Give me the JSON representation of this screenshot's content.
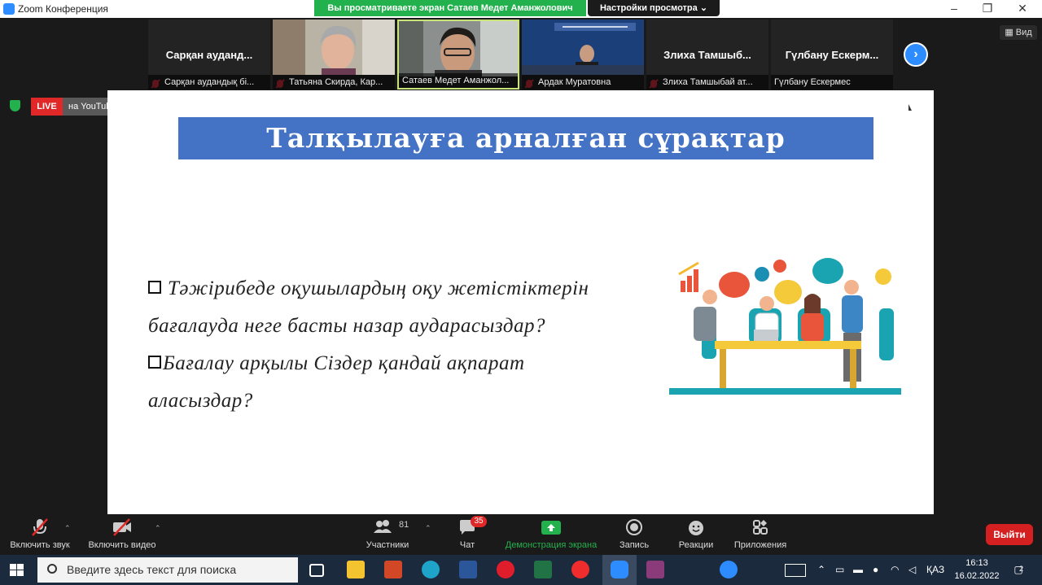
{
  "window": {
    "title": "Zoom Конференция",
    "minimize": "–",
    "restore": "❐",
    "close": "✕"
  },
  "banner": {
    "sharing_text": "Вы просматриваете экран Сатаев Медет Аманжолович",
    "view_options": "Настройки просмотра ⌄"
  },
  "view_button": "▦ Вид",
  "participants": [
    {
      "big": "Сарқан ауданд...",
      "label": "Сарқан аудандық бі...",
      "muted": true,
      "video": false
    },
    {
      "big": "",
      "label": "Татьяна Скирда, Кар...",
      "muted": true,
      "video": true
    },
    {
      "big": "",
      "label": "Сатаев Медет Аманжол...",
      "muted": false,
      "video": true
    },
    {
      "big": "",
      "label": "Ардак Муратовна",
      "muted": true,
      "video": true
    },
    {
      "big": "Злиха Тамшыб...",
      "label": "Злиха Тамшыбай ат...",
      "muted": true,
      "video": false
    },
    {
      "big": "Гүлбану Ескерм...",
      "label": "Гүлбану Ескермес",
      "muted": false,
      "video": false
    }
  ],
  "live": {
    "badge": "LIVE",
    "destination": "на YouTube ▾"
  },
  "slide": {
    "title": "Талқылауға арналған сұрақтар",
    "question1_line1": "Тәжірибеде оқушылардың оқу жетістіктерін",
    "question1_line2": "бағалауда неге басты назар аударасыздар?",
    "question2_line1": "Бағалау арқылы Сіздер қандай ақпарат",
    "question2_line2": "аласыздар?"
  },
  "toolbar": {
    "audio": "Включить звук",
    "video": "Включить видео",
    "participants": "Участники",
    "participants_count": "81",
    "chat": "Чат",
    "chat_badge": "35",
    "share": "Демонстрация экрана",
    "record": "Запись",
    "reactions": "Реакции",
    "apps": "Приложения",
    "leave": "Выйти"
  },
  "taskbar": {
    "search_placeholder": "Введите здесь текст для поиска",
    "lang": "ҚАЗ",
    "time": "16:13",
    "date": "16.02.2022",
    "notif_count": "2"
  },
  "colors": {
    "zoom_blue": "#2d8cff",
    "share_green": "#23b14d",
    "slide_banner": "#4472c4",
    "leave_red": "#d42020"
  }
}
